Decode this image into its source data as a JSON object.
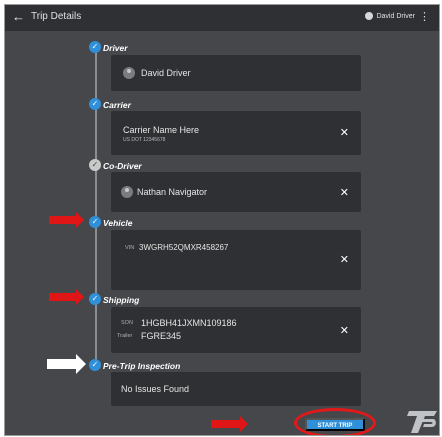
{
  "header": {
    "title": "Trip Details",
    "user_name": "David Driver",
    "back_icon": "arrow-left-icon",
    "menu_icon": "more-vert-icon"
  },
  "steps": [
    {
      "label": "Driver",
      "name": "David Driver"
    },
    {
      "label": "Carrier",
      "name": "Carrier Name Here",
      "sub": "US DOT 12345678"
    },
    {
      "label": "Co-Driver",
      "name": "Nathan Navigator"
    },
    {
      "label": "Vehicle",
      "vin_label": "VIN",
      "vin": "3WGRH52QMXR458267"
    },
    {
      "label": "Shipping",
      "son_label": "SON",
      "son": "1HGBH41JXMN109186",
      "trailer_label": "Trailer",
      "trailer": "FGRE345"
    },
    {
      "label": "Pre-Trip Inspection",
      "value": "No Issues Found"
    }
  ],
  "start_button": "START TRIP",
  "colors": {
    "accent": "#2f8fd8",
    "annotation": "#e01515",
    "background": "#45474b",
    "card": "#2f3033"
  }
}
